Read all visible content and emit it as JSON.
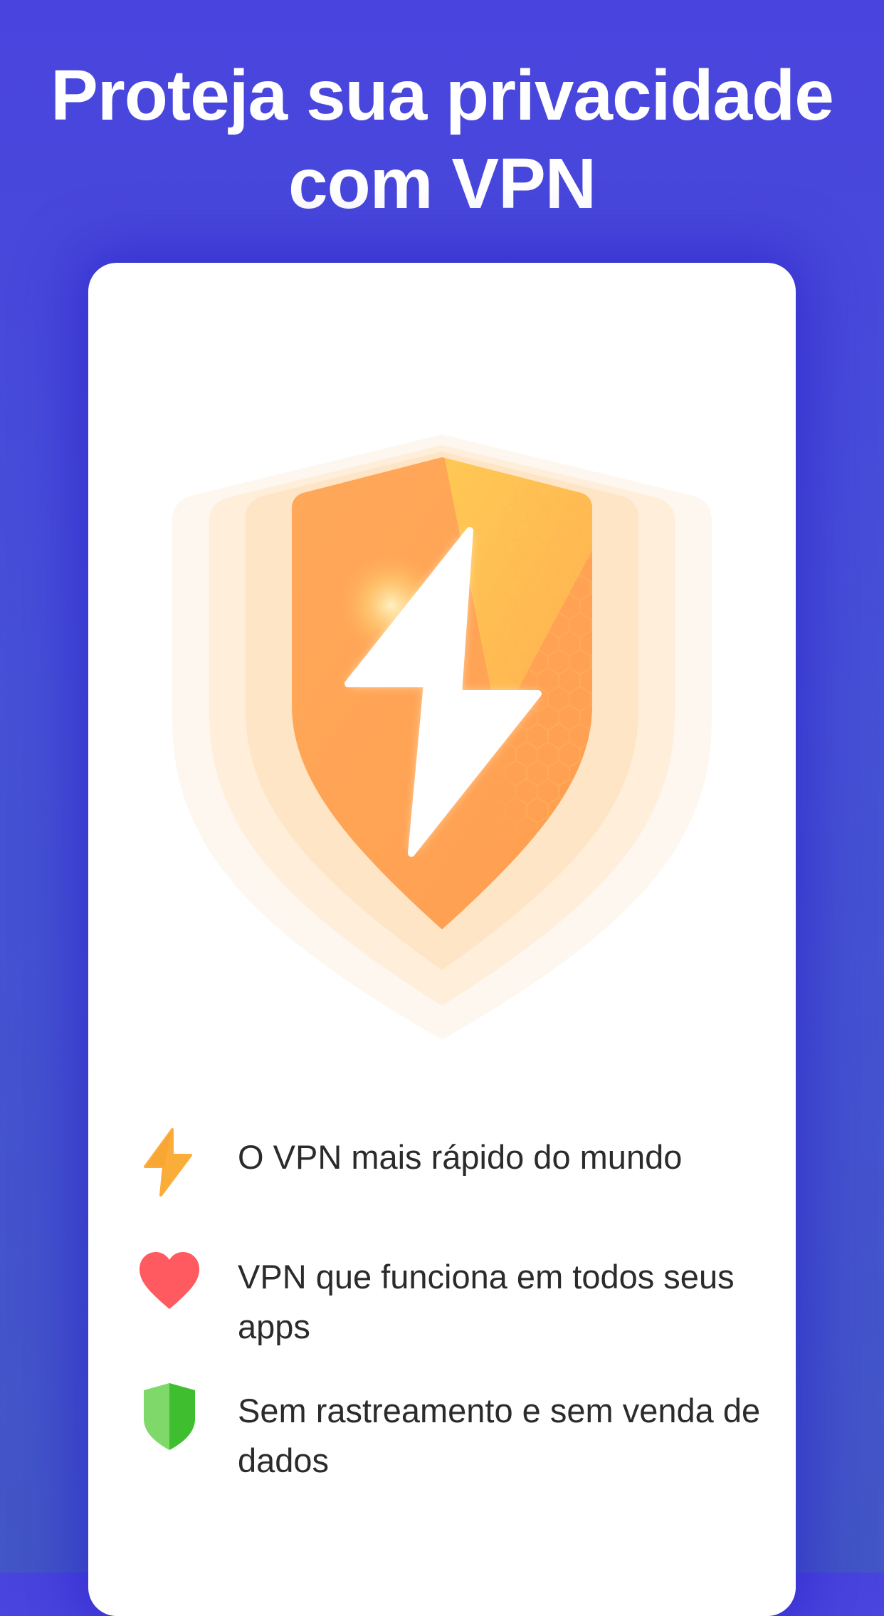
{
  "header": {
    "title_line1": "Proteja sua privacidade",
    "title_line2": "com VPN"
  },
  "hero": {
    "icon": "shield-lightning-icon",
    "colors": {
      "shield": "#ffa350",
      "shield_highlight": "#ffc04f",
      "glow": "#fde7cc",
      "bolt": "#ffffff"
    }
  },
  "features": [
    {
      "icon": "lightning-icon",
      "color": "#fbad3a",
      "text": "O VPN mais rápido do mundo"
    },
    {
      "icon": "heart-icon",
      "color": "#ff5a5f",
      "text": "VPN que funciona em todos seus apps"
    },
    {
      "icon": "shield-icon",
      "color": "#4cc73f",
      "text": "Sem rastreamento e sem venda de dados"
    }
  ],
  "colors": {
    "background": "#4848dc",
    "card": "#ffffff",
    "title_text": "#ffffff",
    "body_text": "#2b2b2b"
  }
}
